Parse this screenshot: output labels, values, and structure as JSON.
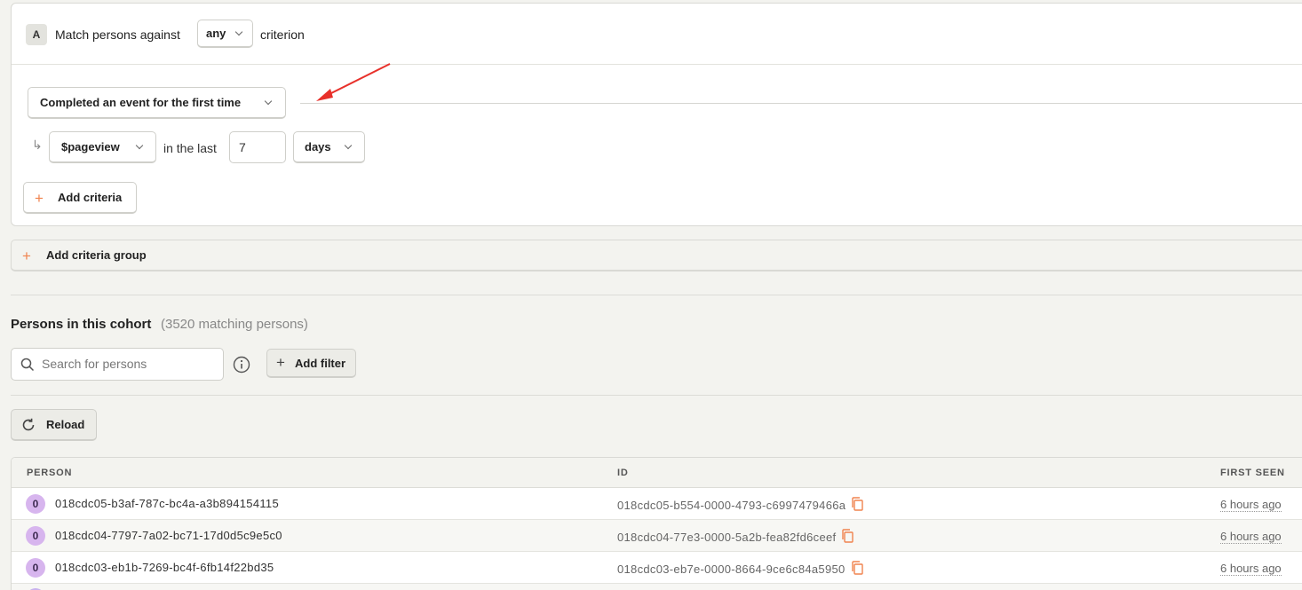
{
  "group": {
    "badge": "A",
    "match_prefix": "Match persons against",
    "match_value": "any",
    "match_suffix": "criterion",
    "criteria": {
      "type_label": "Completed an event for the first time",
      "event_label": "$pageview",
      "in_last_label": "in the last",
      "count_value": "7",
      "unit_label": "days"
    },
    "add_criteria_label": "Add criteria"
  },
  "add_group_label": "Add criteria group",
  "persons": {
    "title": "Persons in this cohort",
    "count_text": "(3520 matching persons)",
    "search_placeholder": "Search for persons",
    "add_filter_label": "Add filter",
    "reload_label": "Reload",
    "columns": [
      "PERSON",
      "ID",
      "FIRST SEEN"
    ],
    "rows": [
      {
        "avatar": "0",
        "name": "018cdc05-b3af-787c-bc4a-a3b894154115",
        "id": "018cdc05-b554-0000-4793-c6997479466a",
        "first_seen": "6 hours ago"
      },
      {
        "avatar": "0",
        "name": "018cdc04-7797-7a02-bc71-17d0d5c9e5c0",
        "id": "018cdc04-77e3-0000-5a2b-fea82fd6ceef",
        "first_seen": "6 hours ago"
      },
      {
        "avatar": "0",
        "name": "018cdc03-eb1b-7269-bc4f-6fb14f22bd35",
        "id": "018cdc03-eb7e-0000-8664-9ce6c84a5950",
        "first_seen": "6 hours ago"
      }
    ]
  },
  "colors": {
    "accent_orange": "#f0834e",
    "annotation_red": "#e8302a",
    "avatar_bg": "#d7b5ee"
  }
}
